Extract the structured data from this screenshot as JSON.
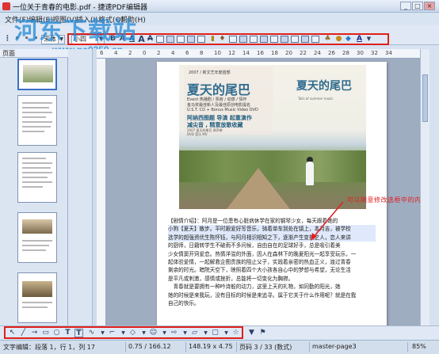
{
  "window": {
    "title": "一位关于青春的电影.pdf - 捷速PDF编辑器",
    "min_label": "_",
    "max_label": "□",
    "close_label": "×"
  },
  "menu": [
    "文件(F)",
    "编辑(E)",
    "视图(V)",
    "插入(I)",
    "格式(O)",
    "帮助(H)"
  ],
  "watermark": {
    "logo_text": "河东下载站",
    "url": "www.pc0359.cn"
  },
  "toolbar": {
    "font_select": "宋体",
    "size_select": "小四",
    "bold": "B",
    "italic": "A",
    "underline": "A",
    "strike": "A",
    "big_a": "A",
    "color_a": "A"
  },
  "left_panel": {
    "header": "页面"
  },
  "ruler": [
    "6",
    "4",
    "2",
    "0",
    "2",
    "4",
    "6",
    "8",
    "10",
    "12",
    "14",
    "16",
    "18",
    "20",
    "22",
    "24",
    "26",
    "28",
    "30",
    "32",
    "34"
  ],
  "cover": {
    "title_left": "夏天的尾巴",
    "title_right": "夏天的尾巴",
    "subtitle": "2007 / 新文艺年度首部",
    "line1": "Event 热播剧 / 票房 / 动感 / 情怀",
    "line2": "金马奖最佳新人及最佳原创电影提名",
    "line3": "U.S.T. CD + Bonus Music Video DVD",
    "line4": "阿纳西图题 导演 起重演作",
    "line5": "减尖音 , 精意放歌收藏",
    "line6": "2007 夏天的尾巴 原声带",
    "line7": "DVD 音乐 MV",
    "right_sub": "Tails of summer music"
  },
  "body_text": [
    "【剧情介绍】：阿月是一位患有心脏病休学在家的钢琴少女，每天跟着她的",
    "小狗【夏天】散步。平时跟爱好写音乐，骑着单车到处在镇上，本月吉，被学校",
    "选学的超强资优生陈怀钰，与阿月相识相知之下，逐渐产生变换之人，恋人来讲",
    "的厨师，日籍转学生不破雨不多问候，自由自在的足球好手，总是吸引着美",
    "少女情窦开窍爱恋。热情洋溢的外面，因人在森林下的晚夏阳光一起享受玩乐，一",
    "起体验爱情，一起解救企图贵族的阻止父子，实践着亲密的热血正义，渡过青春",
    "剩余的时光。暗院天空下，映照着四个大小孩各自心中的梦想与希望，无论生活",
    "是平凡或刺激，感情或挫折，总能将一切变化为胸襟。",
    "　青春就是要拥有一种吟诗般的动力，这里上天的礼物，如同勤的阳光，她",
    "她的时候是来我玩，没有目标的时候是来追寻。属于它关于什么作用呢？就是在我",
    "自己的快乐。"
  ],
  "annotation": "可以随意修改选框中的内容",
  "statusbar": {
    "mode": "文字编辑：段落 1，行 1，列 17",
    "coord1": "0.75 / 166.12",
    "coord2": "148.19 x 4.75",
    "page": "页码 3 / 33 (数式)",
    "master": "master-page3",
    "zoom": "85%"
  }
}
